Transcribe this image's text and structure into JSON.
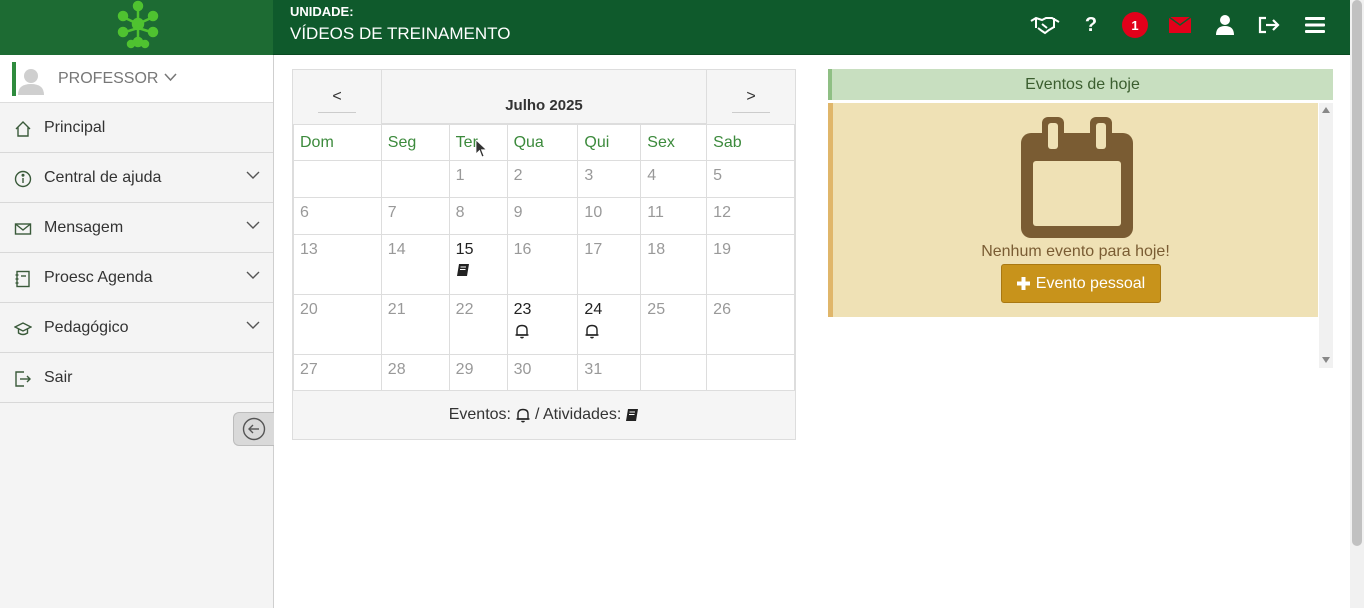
{
  "header": {
    "unit_label": "UNIDADE:",
    "unit_name": "VÍDEOS DE TREINAMENTO",
    "notification_count": "1",
    "icons": [
      "handshake-icon",
      "help-icon",
      "notification-badge",
      "mail-icon",
      "user-icon",
      "logout-icon",
      "hamburger-menu-icon"
    ],
    "colors": {
      "header_bg": "#0f5a2c",
      "logo_bg": "#1d6b33",
      "logo_green": "#4fc230",
      "badge": "#e2001a",
      "mail": "#e2001a"
    }
  },
  "sidebar": {
    "profile_name": "PROFESSOR",
    "items": [
      {
        "label": "Principal",
        "icon": "home-icon",
        "expandable": false
      },
      {
        "label": "Central de ajuda",
        "icon": "info-icon",
        "expandable": true
      },
      {
        "label": "Mensagem",
        "icon": "envelope-icon",
        "expandable": true
      },
      {
        "label": "Proesc Agenda",
        "icon": "agenda-icon",
        "expandable": true
      },
      {
        "label": "Pedagógico",
        "icon": "graduation-cap-icon",
        "expandable": true
      },
      {
        "label": "Sair",
        "icon": "sign-out-icon",
        "expandable": false
      }
    ]
  },
  "calendar": {
    "prev": "<",
    "next": ">",
    "month_label": "Julho 2025",
    "weekdays": [
      "Dom",
      "Seg",
      "Ter",
      "Qua",
      "Qui",
      "Sex",
      "Sab"
    ],
    "weeks": [
      [
        "",
        "",
        "1",
        "2",
        "3",
        "4",
        "5"
      ],
      [
        "6",
        "7",
        "8",
        "9",
        "10",
        "11",
        "12"
      ],
      [
        "13",
        "14",
        "15",
        "16",
        "17",
        "18",
        "19"
      ],
      [
        "20",
        "21",
        "22",
        "23",
        "24",
        "25",
        "26"
      ],
      [
        "27",
        "28",
        "29",
        "30",
        "31",
        "",
        ""
      ]
    ],
    "marked_days": {
      "15": "activity",
      "23": "event",
      "24": "event"
    },
    "legend_events": "Eventos:",
    "legend_sep": "/ Atividades:",
    "colors": {
      "weekday_text": "#3c8a3c",
      "muted_text": "#999999"
    }
  },
  "events_today": {
    "title": "Eventos de hoje",
    "empty_message": "Nenhum evento para hoje!",
    "button_label": "Evento pessoal",
    "colors": {
      "header_bg": "#c8dfc0",
      "box_bg": "#efe1b5",
      "button_bg": "#c8931b",
      "calendar_icon": "#7a5c33"
    }
  }
}
